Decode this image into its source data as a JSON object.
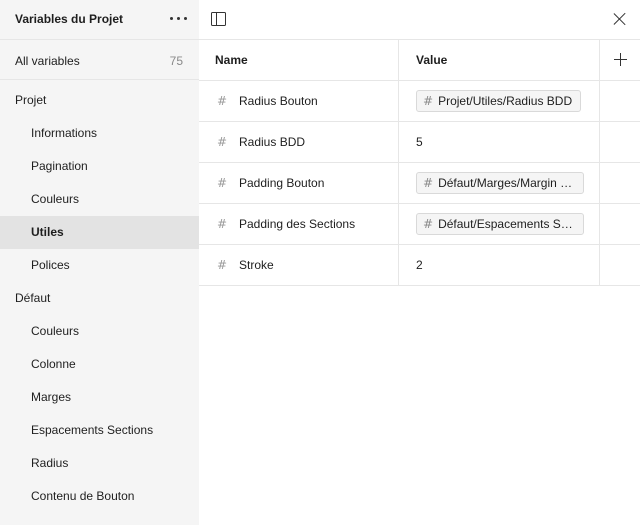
{
  "sidebar": {
    "title": "Variables du Projet",
    "all_variables": {
      "label": "All variables",
      "count": "75"
    },
    "tree": [
      {
        "label": "Projet",
        "level": "group",
        "selected": false
      },
      {
        "label": "Informations",
        "level": "child",
        "selected": false
      },
      {
        "label": "Pagination",
        "level": "child",
        "selected": false
      },
      {
        "label": "Couleurs",
        "level": "child",
        "selected": false
      },
      {
        "label": "Utiles",
        "level": "child",
        "selected": true
      },
      {
        "label": "Polices",
        "level": "child",
        "selected": false
      },
      {
        "label": "Défaut",
        "level": "group",
        "selected": false
      },
      {
        "label": "Couleurs",
        "level": "child",
        "selected": false
      },
      {
        "label": "Colonne",
        "level": "child",
        "selected": false
      },
      {
        "label": "Marges",
        "level": "child",
        "selected": false
      },
      {
        "label": "Espacements Sections",
        "level": "child",
        "selected": false
      },
      {
        "label": "Radius",
        "level": "child",
        "selected": false
      },
      {
        "label": "Contenu de Bouton",
        "level": "child",
        "selected": false
      }
    ]
  },
  "table": {
    "columns": {
      "name": "Name",
      "value": "Value"
    },
    "rows": [
      {
        "name": "Radius Bouton",
        "value": "Projet/Utiles/Radius BDD",
        "alias": true
      },
      {
        "name": "Radius BDD",
        "value": "5",
        "alias": false
      },
      {
        "name": "Padding Bouton",
        "value": "Défaut/Marges/Margin - lg",
        "alias": true
      },
      {
        "name": "Padding des Sections",
        "value": "Défaut/Espacements Se...",
        "alias": true
      },
      {
        "name": "Stroke",
        "value": "2",
        "alias": false
      }
    ]
  },
  "icons": {
    "more": "more-icon",
    "panel": "sidebar-toggle-icon",
    "close": "close-icon",
    "add": "plus-icon",
    "variable": "hash-icon"
  }
}
